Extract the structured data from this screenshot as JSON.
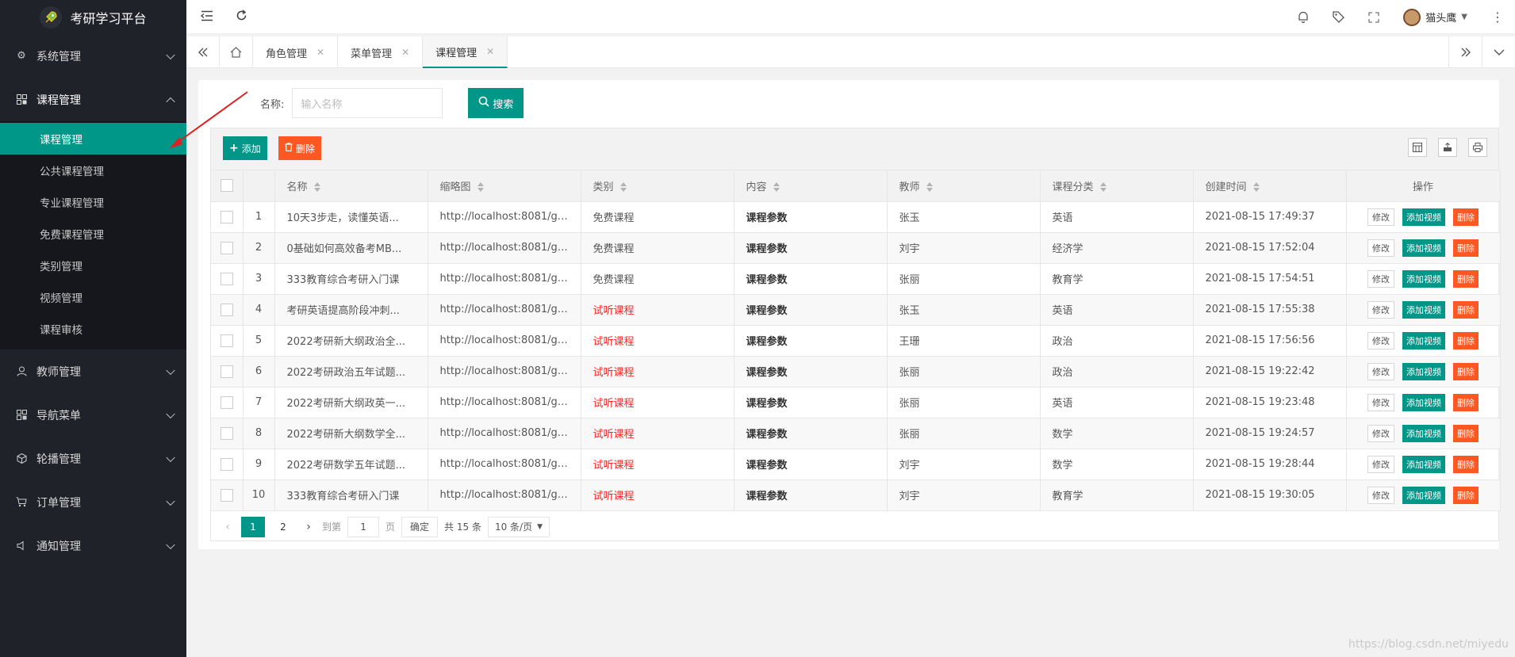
{
  "app": {
    "title": "考研学习平台"
  },
  "sidebar": {
    "items": [
      {
        "label": "系统管理",
        "icon": "gear-icon"
      },
      {
        "label": "课程管理",
        "icon": "apps-icon",
        "open": true
      },
      {
        "label": "教师管理",
        "icon": "user-icon"
      },
      {
        "label": "导航菜单",
        "icon": "apps-icon"
      },
      {
        "label": "轮播管理",
        "icon": "cube-icon"
      },
      {
        "label": "订单管理",
        "icon": "cart-icon"
      },
      {
        "label": "通知管理",
        "icon": "speaker-icon"
      }
    ],
    "submenu": [
      "课程管理",
      "公共课程管理",
      "专业课程管理",
      "免费课程管理",
      "类别管理",
      "视频管理",
      "课程审核"
    ],
    "active_sub": "课程管理"
  },
  "header": {
    "username": "猫头鹰"
  },
  "tabs": [
    {
      "label": "角色管理",
      "active": false
    },
    {
      "label": "菜单管理",
      "active": false
    },
    {
      "label": "课程管理",
      "active": true
    }
  ],
  "search": {
    "label": "名称:",
    "placeholder": "输入名称",
    "button": "搜索"
  },
  "toolbar": {
    "add_label": "添加",
    "delete_label": "删除"
  },
  "table": {
    "columns": [
      "名称",
      "缩略图",
      "类别",
      "内容",
      "教师",
      "课程分类",
      "创建时间",
      "操作"
    ],
    "rows": [
      {
        "num": "1",
        "name": "10天3步走，读懂英语...",
        "thumb": "http://localhost:8081/ge...",
        "category": "免费课程",
        "content": "课程参数",
        "teacher": "张玉",
        "type": "英语",
        "created": "2021-08-15 17:49:37"
      },
      {
        "num": "2",
        "name": "0基础如何高效备考MB...",
        "thumb": "http://localhost:8081/ge...",
        "category": "免费课程",
        "content": "课程参数",
        "teacher": "刘宇",
        "type": "经济学",
        "created": "2021-08-15 17:52:04"
      },
      {
        "num": "3",
        "name": "333教育综合考研入门课",
        "thumb": "http://localhost:8081/ge...",
        "category": "免费课程",
        "content": "课程参数",
        "teacher": "张丽",
        "type": "教育学",
        "created": "2021-08-15 17:54:51"
      },
      {
        "num": "4",
        "name": "考研英语提高阶段冲刺...",
        "thumb": "http://localhost:8081/ge...",
        "category": "试听课程",
        "content": "课程参数",
        "teacher": "张玉",
        "type": "英语",
        "created": "2021-08-15 17:55:38"
      },
      {
        "num": "5",
        "name": "2022考研新大纲政治全...",
        "thumb": "http://localhost:8081/ge...",
        "category": "试听课程",
        "content": "课程参数",
        "teacher": "王珊",
        "type": "政治",
        "created": "2021-08-15 17:56:56"
      },
      {
        "num": "6",
        "name": "2022考研政治五年试题...",
        "thumb": "http://localhost:8081/ge...",
        "category": "试听课程",
        "content": "课程参数",
        "teacher": "张丽",
        "type": "政治",
        "created": "2021-08-15 19:22:42"
      },
      {
        "num": "7",
        "name": "2022考研新大纲政英一...",
        "thumb": "http://localhost:8081/ge...",
        "category": "试听课程",
        "content": "课程参数",
        "teacher": "张丽",
        "type": "英语",
        "created": "2021-08-15 19:23:48"
      },
      {
        "num": "8",
        "name": "2022考研新大纲数学全...",
        "thumb": "http://localhost:8081/ge...",
        "category": "试听课程",
        "content": "课程参数",
        "teacher": "张丽",
        "type": "数学",
        "created": "2021-08-15 19:24:57"
      },
      {
        "num": "9",
        "name": "2022考研数学五年试题...",
        "thumb": "http://localhost:8081/ge...",
        "category": "试听课程",
        "content": "课程参数",
        "teacher": "刘宇",
        "type": "数学",
        "created": "2021-08-15 19:28:44"
      },
      {
        "num": "10",
        "name": "333教育综合考研入门课",
        "thumb": "http://localhost:8081/ge...",
        "category": "试听课程",
        "content": "课程参数",
        "teacher": "刘宇",
        "type": "教育学",
        "created": "2021-08-15 19:30:05"
      }
    ],
    "actions": {
      "edit": "修改",
      "video": "添加视频",
      "delete": "删除"
    }
  },
  "pager": {
    "pages": [
      "1",
      "2"
    ],
    "current": "1",
    "goto_prefix": "到第",
    "goto_value": "1",
    "goto_suffix": "页",
    "confirm": "确定",
    "total": "共 15 条",
    "page_size": "10 条/页"
  },
  "watermark": "https://blog.csdn.net/miyedu",
  "colors": {
    "primary": "#009688",
    "danger": "#ff5722",
    "sidebar": "#20222a",
    "highlight_text": "#ff2222",
    "annotation_arrow": "#e02020"
  }
}
